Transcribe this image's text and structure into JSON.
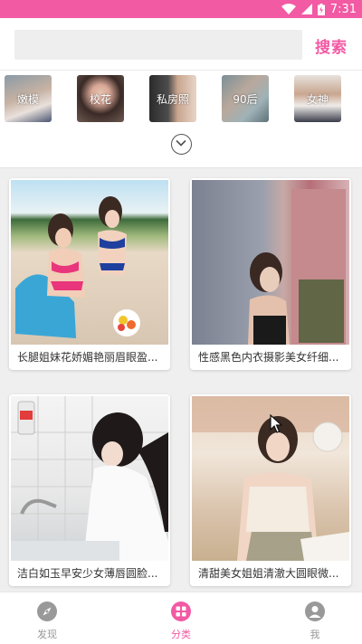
{
  "status": {
    "time": "7:31"
  },
  "search": {
    "placeholder": "",
    "button_label": "搜索"
  },
  "categories": [
    {
      "label": "嫩模"
    },
    {
      "label": "校花"
    },
    {
      "label": "私房照"
    },
    {
      "label": "90后"
    },
    {
      "label": "女神"
    }
  ],
  "cards": [
    {
      "caption": "长腿姐妹花娇媚艳丽眉眼盈..."
    },
    {
      "caption": "性感黑色内衣摄影美女纤细..."
    },
    {
      "caption": "洁白如玉早安少女薄唇圆脸..."
    },
    {
      "caption": "清甜美女姐姐清澈大圆眼微..."
    }
  ],
  "tabs": [
    {
      "label": "发现",
      "icon": "compass-icon",
      "active": false
    },
    {
      "label": "分类",
      "icon": "grid-icon",
      "active": true
    },
    {
      "label": "我",
      "icon": "person-icon",
      "active": false
    }
  ],
  "colors": {
    "accent": "#f25aa3",
    "inactive": "#999999"
  }
}
